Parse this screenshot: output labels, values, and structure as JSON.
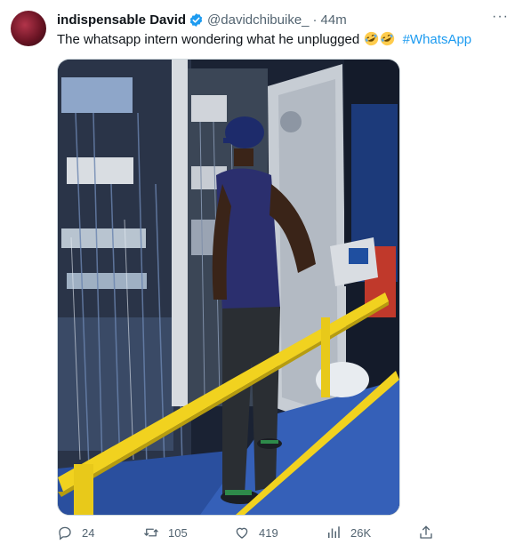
{
  "tweet": {
    "author_name": "indispensable David",
    "handle": "@davidchibuike_",
    "separator": "·",
    "time": "44m",
    "text": "The whatsapp intern wondering what he unplugged",
    "emojis": [
      "rolling-on-floor-laughing",
      "rolling-on-floor-laughing"
    ],
    "hashtag": "#WhatsApp"
  },
  "stats": {
    "replies": "24",
    "retweets": "105",
    "likes": "419",
    "views": "26K"
  },
  "colors": {
    "accent": "#1d9bf0",
    "text": "#0f1419",
    "muted": "#536471",
    "verified": "#1d9bf0"
  },
  "icons": [
    "more-icon",
    "verified-badge-icon",
    "reply-icon",
    "retweet-icon",
    "like-icon",
    "views-icon",
    "share-icon"
  ]
}
